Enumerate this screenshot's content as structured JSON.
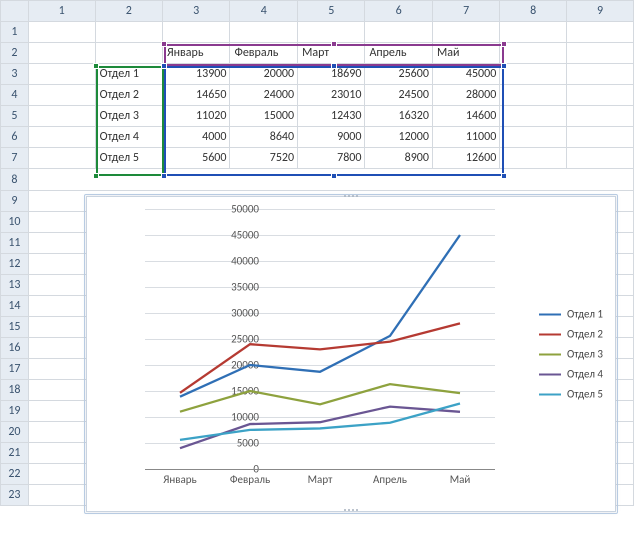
{
  "sheet": {
    "col_headers": [
      "1",
      "2",
      "3",
      "4",
      "5",
      "6",
      "7",
      "8",
      "9"
    ],
    "row_headers": [
      "1",
      "2",
      "3",
      "4",
      "5",
      "6",
      "7",
      "8",
      "9",
      "10",
      "11",
      "12",
      "13",
      "14",
      "15",
      "16",
      "17",
      "18",
      "19",
      "20",
      "21",
      "22",
      "23"
    ],
    "table": {
      "months": [
        "Январь",
        "Февраль",
        "Март",
        "Апрель",
        "Май"
      ],
      "rows": [
        {
          "label": "Отдел 1",
          "vals": [
            "13900",
            "20000",
            "18690",
            "25600",
            "45000"
          ]
        },
        {
          "label": "Отдел 2",
          "vals": [
            "14650",
            "24000",
            "23010",
            "24500",
            "28000"
          ]
        },
        {
          "label": "Отдел 3",
          "vals": [
            "11020",
            "15000",
            "12430",
            "16320",
            "14600"
          ]
        },
        {
          "label": "Отдел 4",
          "vals": [
            "4000",
            "8640",
            "9000",
            "12000",
            "11000"
          ]
        },
        {
          "label": "Отдел 5",
          "vals": [
            "5600",
            "7520",
            "7800",
            "8900",
            "12600"
          ]
        }
      ]
    }
  },
  "chart_data": {
    "type": "line",
    "x": [
      "Январь",
      "Февраль",
      "Март",
      "Апрель",
      "Май"
    ],
    "series": [
      {
        "name": "Отдел 1",
        "color": "#2f6fb5",
        "values": [
          13900,
          20000,
          18690,
          25600,
          45000
        ]
      },
      {
        "name": "Отдел 2",
        "color": "#b53a32",
        "values": [
          14650,
          24000,
          23010,
          24500,
          28000
        ]
      },
      {
        "name": "Отдел 3",
        "color": "#8ea23e",
        "values": [
          11020,
          15000,
          12430,
          16320,
          14600
        ]
      },
      {
        "name": "Отдел 4",
        "color": "#6a5693",
        "values": [
          4000,
          8640,
          9000,
          12000,
          11000
        ]
      },
      {
        "name": "Отдел 5",
        "color": "#3ca2c6",
        "values": [
          5600,
          7520,
          7800,
          8900,
          12600
        ]
      }
    ],
    "ylim": [
      0,
      50000
    ],
    "ystep": 5000,
    "xlabel": "",
    "ylabel": "",
    "title": ""
  },
  "legend_label_prefix": "Отдел "
}
